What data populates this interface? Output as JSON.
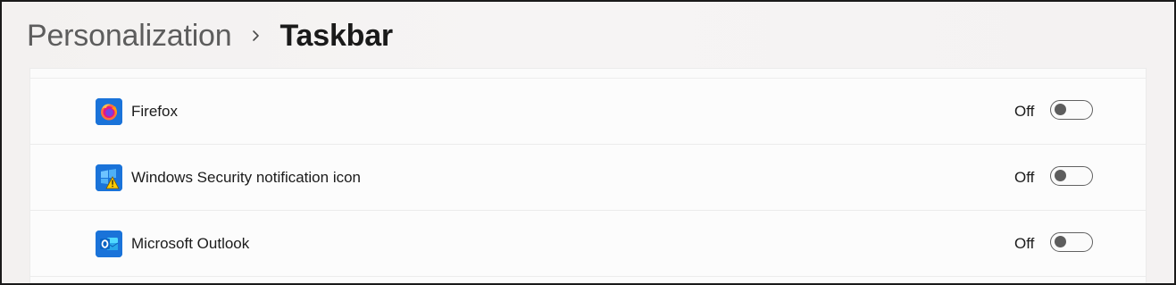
{
  "header": {
    "parent": "Personalization",
    "current": "Taskbar",
    "separator_icon": "chevron-right-icon"
  },
  "items": [
    {
      "name": "Firefox",
      "icon": "firefox-icon",
      "state_label": "Off",
      "on": false
    },
    {
      "name": "Windows Security notification icon",
      "icon": "windows-security-icon",
      "state_label": "Off",
      "on": false
    },
    {
      "name": "Microsoft Outlook",
      "icon": "outlook-icon",
      "state_label": "Off",
      "on": false
    }
  ],
  "colors": {
    "accent_blue": "#1a73d9",
    "toggle_off_border": "#616161",
    "toggle_off_knob": "#5d5d5d"
  }
}
